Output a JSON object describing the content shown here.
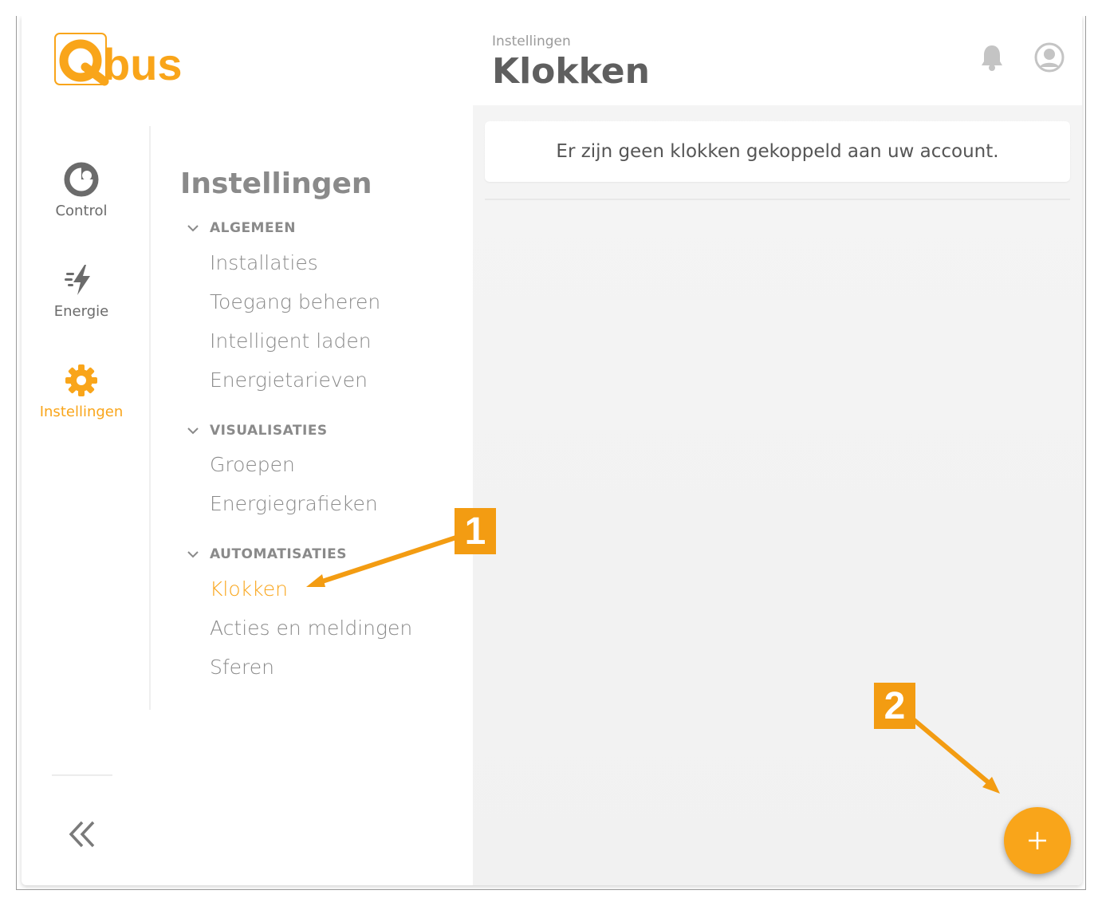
{
  "brand": {
    "logo_text": "Qbus",
    "accent": "#f9a51a"
  },
  "rail": {
    "items": [
      {
        "label": "Control",
        "icon": "control-icon"
      },
      {
        "label": "Energie",
        "icon": "energy-bolt-icon"
      },
      {
        "label": "Instellingen",
        "icon": "gear-icon",
        "active": true
      }
    ],
    "collapse_icon": "double-chevron-left-icon"
  },
  "menu": {
    "title": "Instellingen",
    "sections": [
      {
        "label": "ALGEMEEN",
        "links": [
          "Installaties",
          "Toegang beheren",
          "Intelligent laden",
          "Energietarieven"
        ]
      },
      {
        "label": "VISUALISATIES",
        "links": [
          "Groepen",
          "Energiegrafieken"
        ]
      },
      {
        "label": "AUTOMATISATIES",
        "links": [
          "Klokken",
          "Acties en meldingen",
          "Sferen"
        ]
      }
    ],
    "active_link": "Klokken"
  },
  "header": {
    "breadcrumb": "Instellingen",
    "title": "Klokken",
    "icons": [
      "bell-icon",
      "user-avatar-icon"
    ]
  },
  "main": {
    "empty_message": "Er zijn geen klokken gekoppeld aan uw account.",
    "fab_icon": "plus-icon"
  },
  "annotations": {
    "callout_1": "1",
    "callout_2": "2",
    "color": "#f39c12"
  }
}
